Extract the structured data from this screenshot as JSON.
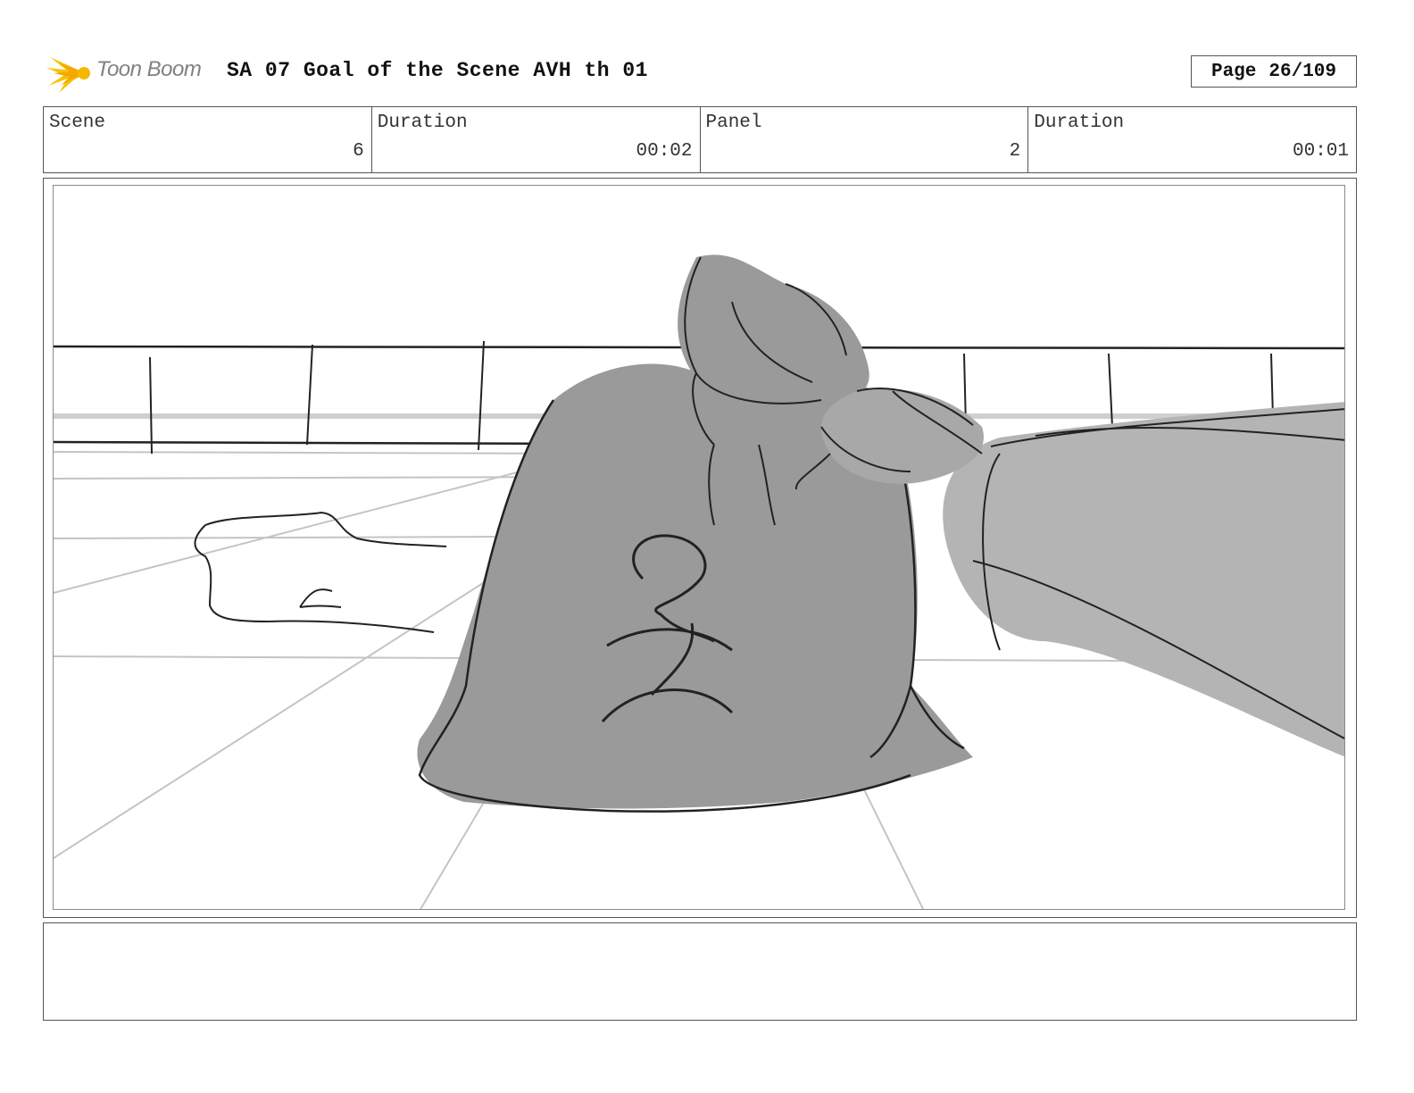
{
  "header": {
    "logo_text": "Toon Boom",
    "title": "SA 07 Goal of the Scene AVH th 01",
    "page_label": "Page",
    "page_value": "26/109"
  },
  "info": {
    "scene_label": "Scene",
    "scene_value": "6",
    "scene_duration_label": "Duration",
    "scene_duration_value": "00:02",
    "panel_label": "Panel",
    "panel_value": "2",
    "panel_duration_label": "Duration",
    "panel_duration_value": "00:01"
  },
  "panel_sketch": {
    "subject": "hand lifting a tied garbage bag on a tiled floor",
    "fill_color": "#9a9a9a",
    "arm_color": "#b4b4b4"
  },
  "notes": {
    "text": ""
  }
}
